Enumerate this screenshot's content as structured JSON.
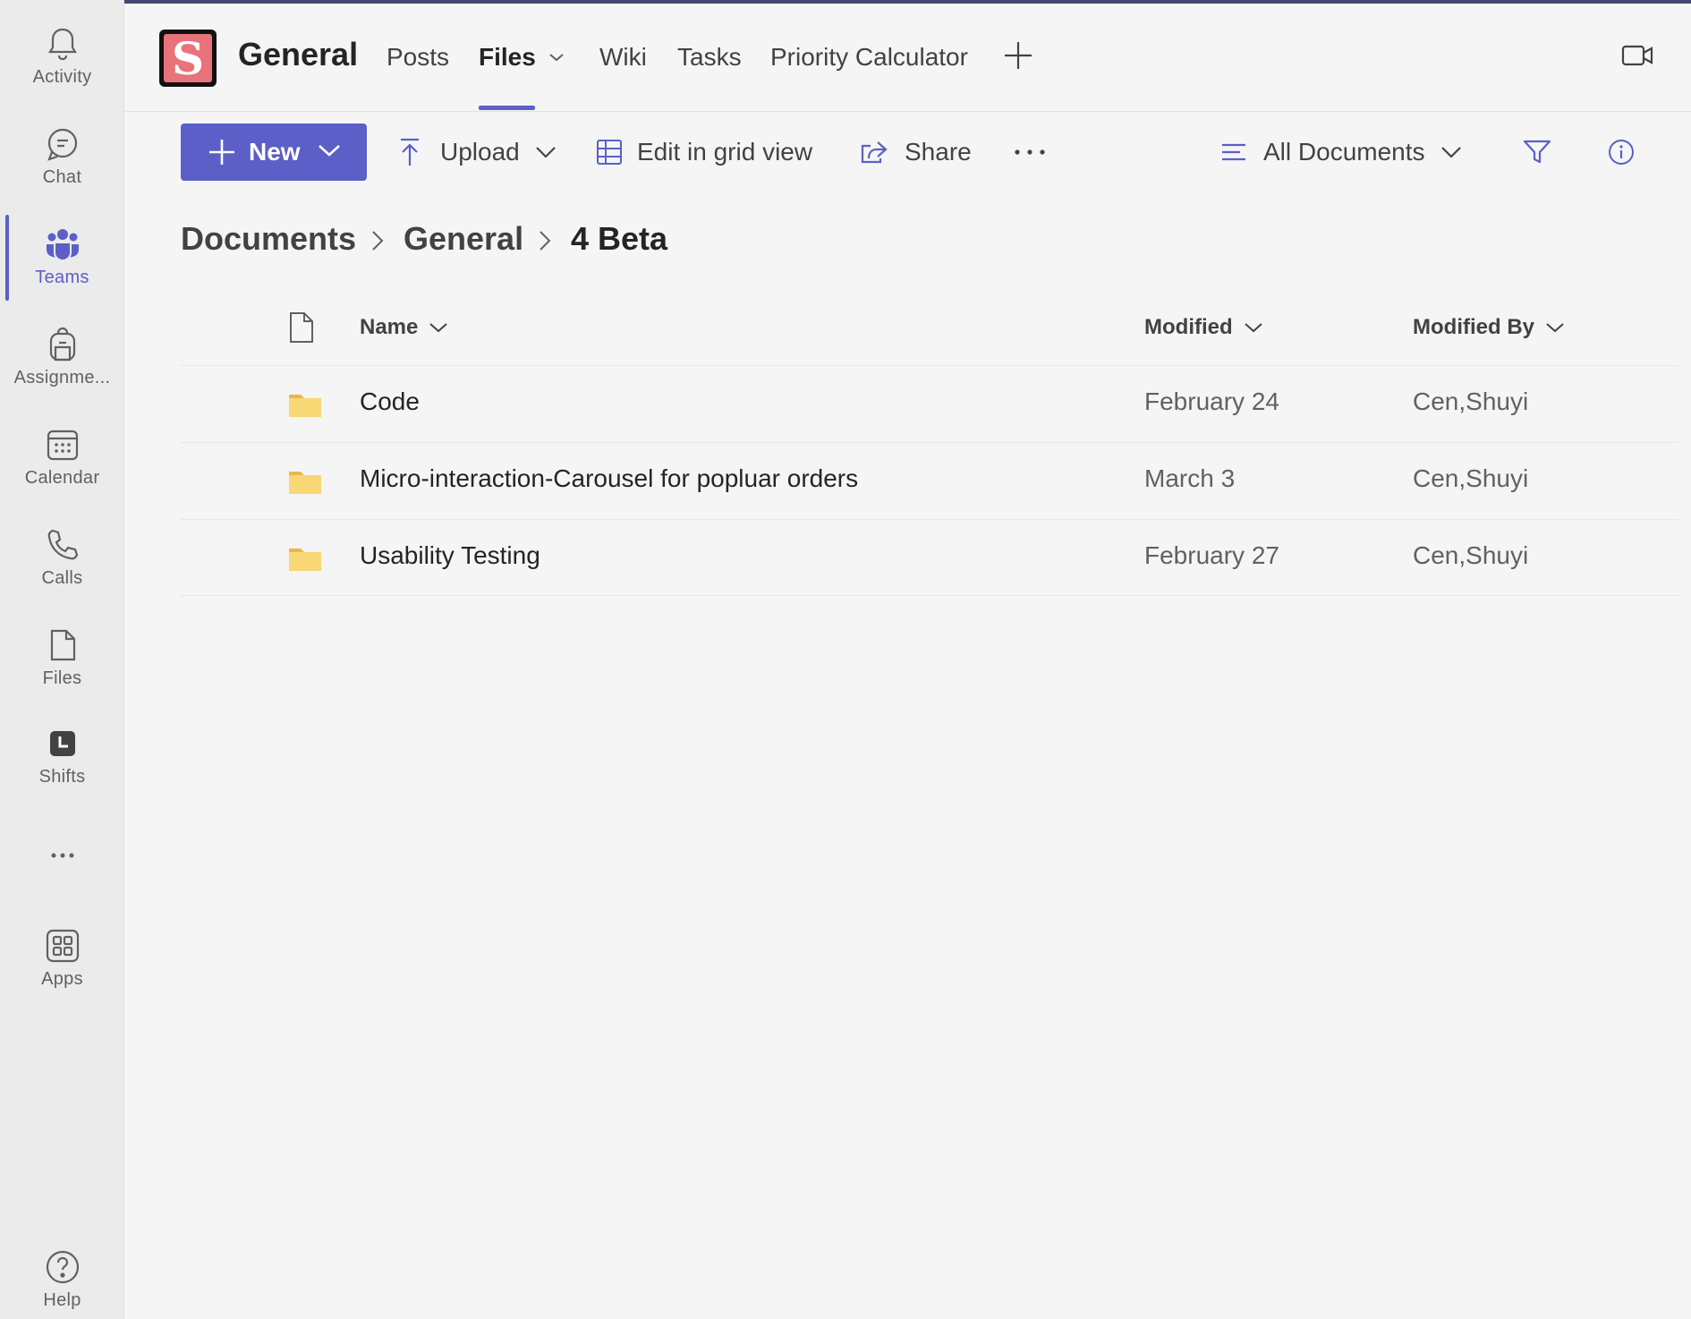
{
  "rail": {
    "items": [
      {
        "label": "Activity",
        "icon": "bell-icon"
      },
      {
        "label": "Chat",
        "icon": "chat-icon"
      },
      {
        "label": "Teams",
        "icon": "teams-icon"
      },
      {
        "label": "Assignme...",
        "icon": "backpack-icon"
      },
      {
        "label": "Calendar",
        "icon": "calendar-icon"
      },
      {
        "label": "Calls",
        "icon": "phone-icon"
      },
      {
        "label": "Files",
        "icon": "file-icon"
      },
      {
        "label": "Shifts",
        "icon": "clock-icon"
      },
      {
        "label": "",
        "icon": "more-icon"
      },
      {
        "label": "Apps",
        "icon": "apps-icon"
      },
      {
        "label": "Help",
        "icon": "help-icon"
      }
    ],
    "active_label": "Teams"
  },
  "header": {
    "team_logo_letter": "S",
    "channel_title": "General",
    "tabs": [
      {
        "label": "Posts"
      },
      {
        "label": "Files",
        "active": true
      },
      {
        "label": "Wiki"
      },
      {
        "label": "Tasks"
      },
      {
        "label": "Priority Calculator"
      }
    ]
  },
  "toolbar": {
    "new_label": "New",
    "upload_label": "Upload",
    "grid_label": "Edit in grid view",
    "share_label": "Share",
    "more_label": "···",
    "view_label": "All Documents"
  },
  "breadcrumb": [
    "Documents",
    "General",
    "4 Beta"
  ],
  "table": {
    "columns": {
      "name": "Name",
      "modified": "Modified",
      "modified_by": "Modified By"
    },
    "rows": [
      {
        "name": "Code",
        "modified": "February 24",
        "modified_by": "Cen,Shuyi"
      },
      {
        "name": "Micro-interaction-Carousel for popluar orders",
        "modified": "March 3",
        "modified_by": "Cen,Shuyi"
      },
      {
        "name": "Usability Testing",
        "modified": "February 27",
        "modified_by": "Cen,Shuyi"
      }
    ]
  },
  "colors": {
    "accent": "#5b5fc7",
    "folder": "#f8d775",
    "logo_bg": "#e8737b"
  }
}
